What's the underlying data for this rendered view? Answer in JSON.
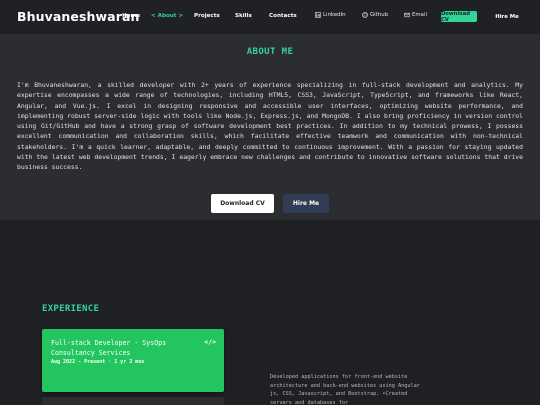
{
  "nav": {
    "brand": "Bhuvaneshwaran",
    "links": [
      "Home",
      "< About >",
      "Projects",
      "Skills",
      "Contacts"
    ],
    "social": [
      {
        "label": "LinkedIn",
        "icon": "linkedin-icon"
      },
      {
        "label": "Github",
        "icon": "github-icon"
      },
      {
        "label": "Email",
        "icon": "email-icon"
      }
    ],
    "download_cv": "Download CV",
    "hire_me": "Hire Me"
  },
  "about": {
    "title": "ABOUT ME",
    "text": "I'm Bhuvaneshwaran, a skilled developer with 2+ years of experience specializing in full-stack development and analytics. My expertise encompasses a wide range of technologies, including HTML5, CSS3, JavaScript, TypeScript, and frameworks like React, Angular, and Vue.js. I excel in designing responsive and accessible user interfaces, optimizing website performance, and implementing robust server-side logic with tools like Node.js, Express.js, and MongoDB. I also bring proficiency in version control using Git/GitHub and have a strong grasp of software development best practices. In addition to my technical prowess, I possess excellent communication and collaboration skills, which facilitate effective teamwork and communication with non-technical stakeholders. I'm a quick learner, adaptable, and deeply committed to continuous improvement. With a passion for staying updated with the latest web development trends, I eagerly embrace new challenges and contribute to innovative software solutions that drive business success.",
    "download_cv": "Download CV",
    "hire_me": "Hire Me"
  },
  "experience": {
    "title": "EXPERIENCE",
    "card": {
      "title": "Full-stack Developer - SysOps Consultancy Services",
      "date": "Aug 2022 - Present · 1 yr 3 mos",
      "icon": "</>"
    },
    "description": "Developed applications for front-end website architecture and back-end websites using Angular js, CSS, Javascript, and Bootstrap. •Created servers and databases for"
  },
  "colors": {
    "accent": "#34d399",
    "card": "#22c55e",
    "background": "#2b2d31",
    "navbar": "#1f2125"
  }
}
